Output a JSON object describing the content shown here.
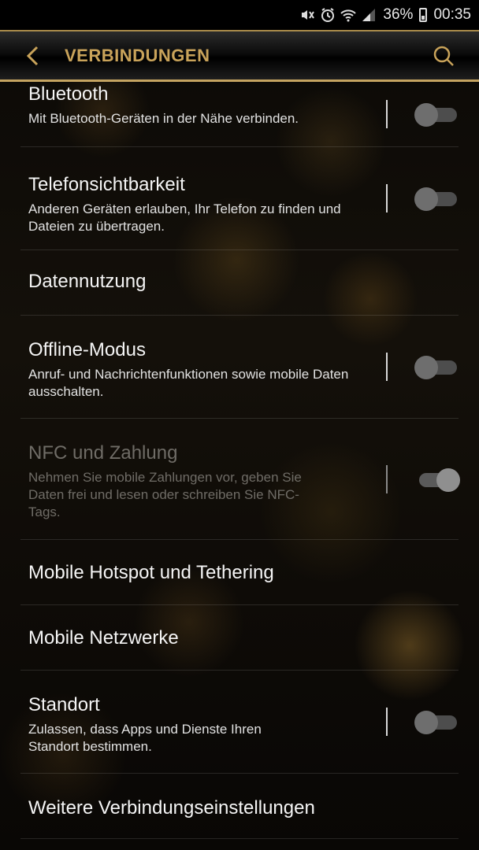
{
  "status_bar": {
    "battery": "36%",
    "time": "00:35"
  },
  "header": {
    "title": "VERBINDUNGEN"
  },
  "settings": [
    {
      "title": "Bluetooth",
      "subtitle": "Mit Bluetooth-Geräten in der Nähe verbinden.",
      "toggle": "off"
    },
    {
      "title": "Telefonsichtbarkeit",
      "subtitle": "Anderen Geräten erlauben, Ihr Telefon zu finden und Dateien zu übertragen.",
      "toggle": "off"
    },
    {
      "title": "Datennutzung"
    },
    {
      "title": "Offline-Modus",
      "subtitle": "Anruf- und Nachrichtenfunktionen sowie mobile Daten ausschalten.",
      "toggle": "off"
    },
    {
      "title": "NFC und Zahlung",
      "subtitle": "Nehmen Sie mobile Zahlungen vor, geben Sie Daten frei und lesen oder schreiben Sie NFC-Tags.",
      "toggle": "on",
      "disabled": true
    },
    {
      "title": "Mobile Hotspot und Tethering"
    },
    {
      "title": "Mobile Netzwerke"
    },
    {
      "title": "Standort",
      "subtitle": "Zulassen, dass Apps und Dienste Ihren Standort bestimmen.",
      "toggle": "off"
    },
    {
      "title": "Weitere Verbindungseinstellungen"
    }
  ],
  "colors": {
    "accent": "#c9a35a",
    "gold_line": "#c5a461"
  },
  "icons": [
    "mute-icon",
    "alarm-icon",
    "wifi-icon",
    "signal-icon",
    "battery-icon",
    "back-arrow-icon",
    "search-icon"
  ]
}
